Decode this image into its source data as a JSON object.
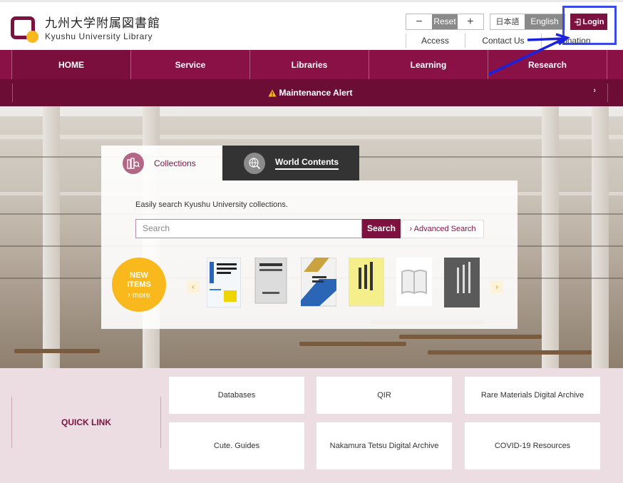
{
  "header": {
    "logo_jp": "九州大学附属図書館",
    "logo_en": "Kyushu University Library",
    "font_minus": "−",
    "font_reset": "Reset",
    "font_plus": "+",
    "lang_ja": "日本語",
    "lang_en": "English",
    "login_label": "Login",
    "util_links": [
      "Access",
      "Contact Us",
      "Donation"
    ]
  },
  "nav": {
    "items": [
      "HOME",
      "Service",
      "Libraries",
      "Learning",
      "Research"
    ]
  },
  "alert": {
    "label": "Maintenance Alert",
    "chevron": "›"
  },
  "search": {
    "tabs": [
      "Collections",
      "World Contents"
    ],
    "description": "Easily search Kyushu University collections.",
    "placeholder": "Search",
    "button": "Search",
    "advanced": "Advanced Search",
    "new_items": "NEW ITEMS",
    "more": "more",
    "prev": "‹",
    "next": "›"
  },
  "quick_links": {
    "label": "QUICK LINK",
    "items": [
      "Databases",
      "QIR",
      "Rare Materials Digital Archive",
      "Cute. Guides",
      "Nakamura Tetsu Digital Archive",
      "COVID-19 Resources"
    ]
  },
  "colors": {
    "brand": "#7d1241",
    "accent": "#f9b81b",
    "highlight_box": "#3b49e6"
  }
}
